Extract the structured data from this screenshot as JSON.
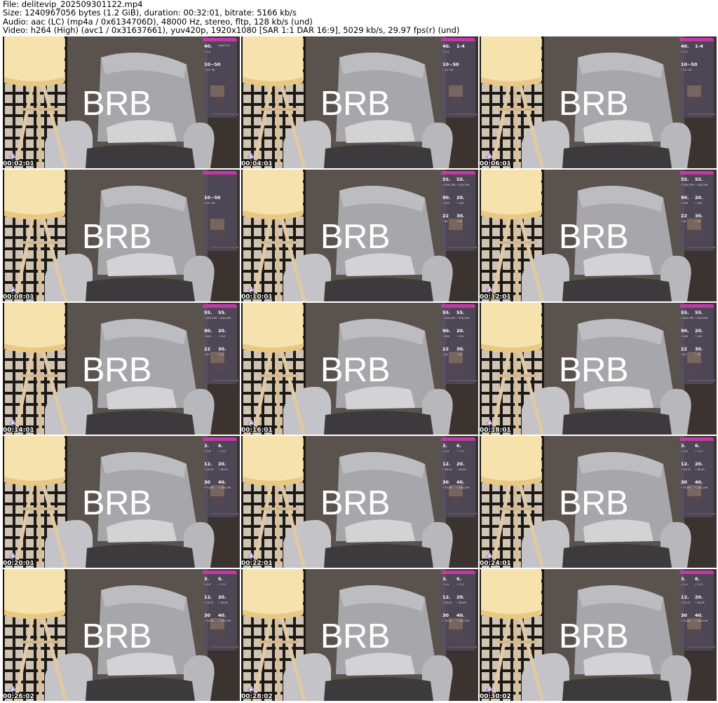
{
  "header": {
    "file": "File: delitevip_202509301122.mp4",
    "size": "Size: 1240967056 bytes (1.2 GiB), duration: 00:32:01, bitrate: 5166 kb/s",
    "audio": "Audio: aac (LC) (mp4a / 0x6134706D), 48000 Hz, stereo, fltp, 128 kb/s (und)",
    "video": "Video: h264 (High) (avc1 / 0x31637661), yuv420p, 1920x1080 [SAR 1:1 DAR 16:9], 5029 kb/s, 29.97 fps(r) (und)"
  },
  "overlay_text": "BRB",
  "thumbnails": [
    {
      "timestamp": "00:02:01",
      "tips": [
        {
          "amt": "40.",
          "lvl": "• 1-4"
        },
        {
          "amt": "",
          "lvl": "Level 1-4"
        },
        {
          "amt": "10~50",
          "lvl": "• 10~50"
        }
      ]
    },
    {
      "timestamp": "00:04:01",
      "tips": [
        {
          "amt": "40.",
          "lvl": "• 1-4"
        },
        {
          "amt": "1-4",
          "lvl": ""
        },
        {
          "amt": "10~50",
          "lvl": "• 10~50"
        }
      ]
    },
    {
      "timestamp": "00:06:01",
      "tips": [
        {
          "amt": "40.",
          "lvl": "• 1-4"
        },
        {
          "amt": "1-4",
          "lvl": ""
        },
        {
          "amt": "10~50",
          "lvl": "• 10~50"
        }
      ]
    },
    {
      "timestamp": "00:08:01",
      "tips": [
        {
          "amt": "",
          "lvl": ""
        },
        {
          "amt": "",
          "lvl": ""
        },
        {
          "amt": "10~50",
          "lvl": "• 10~50"
        }
      ]
    },
    {
      "timestamp": "00:10:01",
      "tips": [
        {
          "amt": "55.",
          "lvl": "• 200-299"
        },
        {
          "amt": "55.",
          "lvl": "• 200-299"
        },
        {
          "amt": "90.",
          "lvl": "• 400"
        },
        {
          "amt": "20.",
          "lvl": "• 100"
        },
        {
          "amt": "22",
          "lvl": "• 40"
        },
        {
          "amt": "30.",
          "lvl": "• 50"
        }
      ]
    },
    {
      "timestamp": "00:12:01",
      "tips": [
        {
          "amt": "55.",
          "lvl": "• 200-299"
        },
        {
          "amt": "55.",
          "lvl": "• 200-299"
        },
        {
          "amt": "90.",
          "lvl": "• 400"
        },
        {
          "amt": "20.",
          "lvl": "• 100"
        },
        {
          "amt": "22",
          "lvl": "• 40"
        },
        {
          "amt": "30.",
          "lvl": "• 50"
        }
      ]
    },
    {
      "timestamp": "00:14:01",
      "tips": [
        {
          "amt": "55.",
          "lvl": "• 200-299"
        },
        {
          "amt": "55.",
          "lvl": "• 200-299"
        },
        {
          "amt": "90.",
          "lvl": "• 400"
        },
        {
          "amt": "20.",
          "lvl": "• 100"
        },
        {
          "amt": "22",
          "lvl": "• 40"
        },
        {
          "amt": "30.",
          "lvl": "• 50"
        }
      ]
    },
    {
      "timestamp": "00:16:01",
      "tips": [
        {
          "amt": "55.",
          "lvl": "• 200-299"
        },
        {
          "amt": "55.",
          "lvl": "• 200-299"
        },
        {
          "amt": "90.",
          "lvl": "• 400"
        },
        {
          "amt": "20.",
          "lvl": "• 100"
        },
        {
          "amt": "22",
          "lvl": "• 40"
        },
        {
          "amt": "30.",
          "lvl": "• 50"
        }
      ]
    },
    {
      "timestamp": "00:18:01",
      "tips": [
        {
          "amt": "55.",
          "lvl": "• 200-299"
        },
        {
          "amt": "55.",
          "lvl": "• 200-299"
        },
        {
          "amt": "90.",
          "lvl": "• 400"
        },
        {
          "amt": "20.",
          "lvl": "• 100"
        },
        {
          "amt": "22",
          "lvl": "• 40"
        },
        {
          "amt": "30.",
          "lvl": "• 50"
        }
      ]
    },
    {
      "timestamp": "00:20:01",
      "tips": [
        {
          "amt": "3.",
          "lvl": "• 1-6"
        },
        {
          "amt": "6.",
          "lvl": "• 7-11"
        },
        {
          "amt": "12.",
          "lvl": "• 16-22"
        },
        {
          "amt": "20.",
          "lvl": "• 36-49"
        },
        {
          "amt": "30",
          "lvl": "• 70-99"
        },
        {
          "amt": "40.",
          "lvl": "• 100-199"
        }
      ]
    },
    {
      "timestamp": "00:22:01",
      "tips": [
        {
          "amt": "3.",
          "lvl": "• 1-6"
        },
        {
          "amt": "6.",
          "lvl": "• 7-11"
        },
        {
          "amt": "12.",
          "lvl": "• 16-22"
        },
        {
          "amt": "20.",
          "lvl": "• 36-49"
        },
        {
          "amt": "30",
          "lvl": "• 70-99"
        },
        {
          "amt": "40.",
          "lvl": "• 100-199"
        }
      ]
    },
    {
      "timestamp": "00:24:01",
      "tips": [
        {
          "amt": "3.",
          "lvl": "• 1-6"
        },
        {
          "amt": "6.",
          "lvl": "• 7-11"
        },
        {
          "amt": "12.",
          "lvl": "• 16-22"
        },
        {
          "amt": "20.",
          "lvl": "• 36-49"
        },
        {
          "amt": "30",
          "lvl": "• 70-99"
        },
        {
          "amt": "40.",
          "lvl": "• 100-199"
        }
      ]
    },
    {
      "timestamp": "00:26:02",
      "tips": [
        {
          "amt": "3.",
          "lvl": "• 1-6"
        },
        {
          "amt": "6.",
          "lvl": "• 7-11"
        },
        {
          "amt": "12.",
          "lvl": "• 16-22"
        },
        {
          "amt": "20.",
          "lvl": "• 36-49"
        },
        {
          "amt": "30",
          "lvl": "• 70-99"
        },
        {
          "amt": "40.",
          "lvl": "• 100-199"
        }
      ]
    },
    {
      "timestamp": "00:28:02",
      "tips": [
        {
          "amt": "3.",
          "lvl": "• 1-6"
        },
        {
          "amt": "6.",
          "lvl": "• 7-11"
        },
        {
          "amt": "12.",
          "lvl": "• 16-22"
        },
        {
          "amt": "20.",
          "lvl": "• 36-49"
        },
        {
          "amt": "30",
          "lvl": "• 70-99"
        },
        {
          "amt": "40.",
          "lvl": "• 100-199"
        }
      ]
    },
    {
      "timestamp": "00:30:02",
      "tips": [
        {
          "amt": "3.",
          "lvl": "• 1-6"
        },
        {
          "amt": "6.",
          "lvl": "• 7-11"
        },
        {
          "amt": "12.",
          "lvl": "• 16-22"
        },
        {
          "amt": "20.",
          "lvl": "• 36-49"
        },
        {
          "amt": "30",
          "lvl": "• 70-99"
        },
        {
          "amt": "40.",
          "lvl": "• 100-199"
        }
      ]
    }
  ],
  "colors": {
    "wall": "#4d4642",
    "screen_frame": "#1b1714",
    "screen_panel": "#d8cfc2",
    "lamp_shade": "#f7e3b0",
    "chair": "#b6b6ba",
    "overlay_accent": "#c23aa8"
  },
  "icons": {
    "watermark": "flower-icon"
  }
}
